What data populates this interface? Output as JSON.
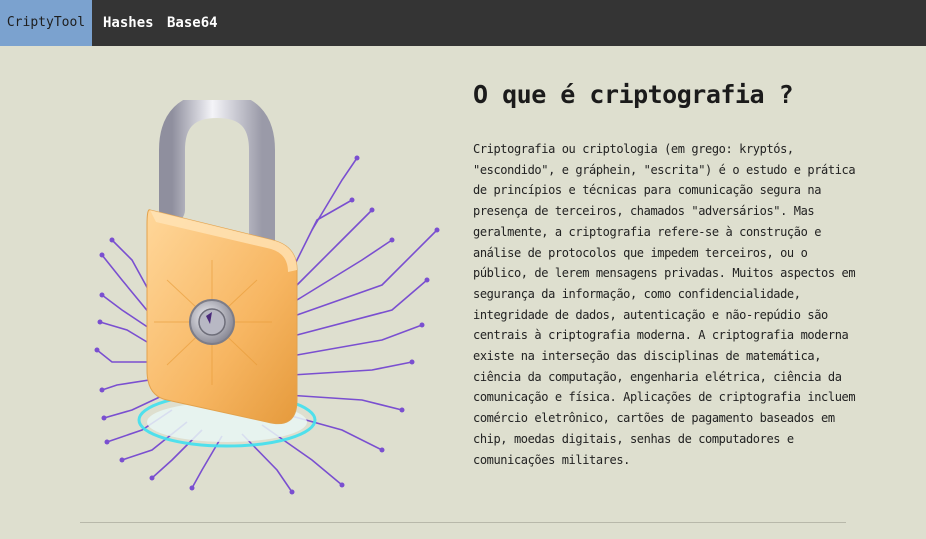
{
  "navbar": {
    "brand": "CriptyTool",
    "items": [
      {
        "label": "Hashes"
      },
      {
        "label": "Base64"
      }
    ]
  },
  "main": {
    "title": "O que é criptografia ?",
    "description": "Criptografia ou criptologia (em grego: kryptós, \"escondido\", e gráphein, \"escrita\") é o estudo e prática de princípios e técnicas para comunicação segura na presença de terceiros, chamados \"adversários\". Mas geralmente, a criptografia refere-se à construção e análise de protocolos que impedem terceiros, ou o público, de lerem mensagens privadas. Muitos aspectos em segurança da informação, como confidencialidade, integridade de dados, autenticação e não-repúdio são centrais à criptografia moderna. A criptografia moderna existe na interseção das disciplinas de matemática, ciência da computação, engenharia elétrica, ciência da comunicação e física. Aplicações de criptografia incluem comércio eletrônico, cartões de pagamento baseados em chip, moedas digitais, senhas de computadores e comunicações militares."
  },
  "illustration": {
    "icon": "padlock-circuit-illustration"
  },
  "colors": {
    "navbar_bg": "#343434",
    "brand_bg": "#7ba2cf",
    "page_bg": "#dedfcf",
    "lock_body": "#f7b662",
    "circuit_lines": "#7a4fd0",
    "glow": "#3fe0ee"
  }
}
